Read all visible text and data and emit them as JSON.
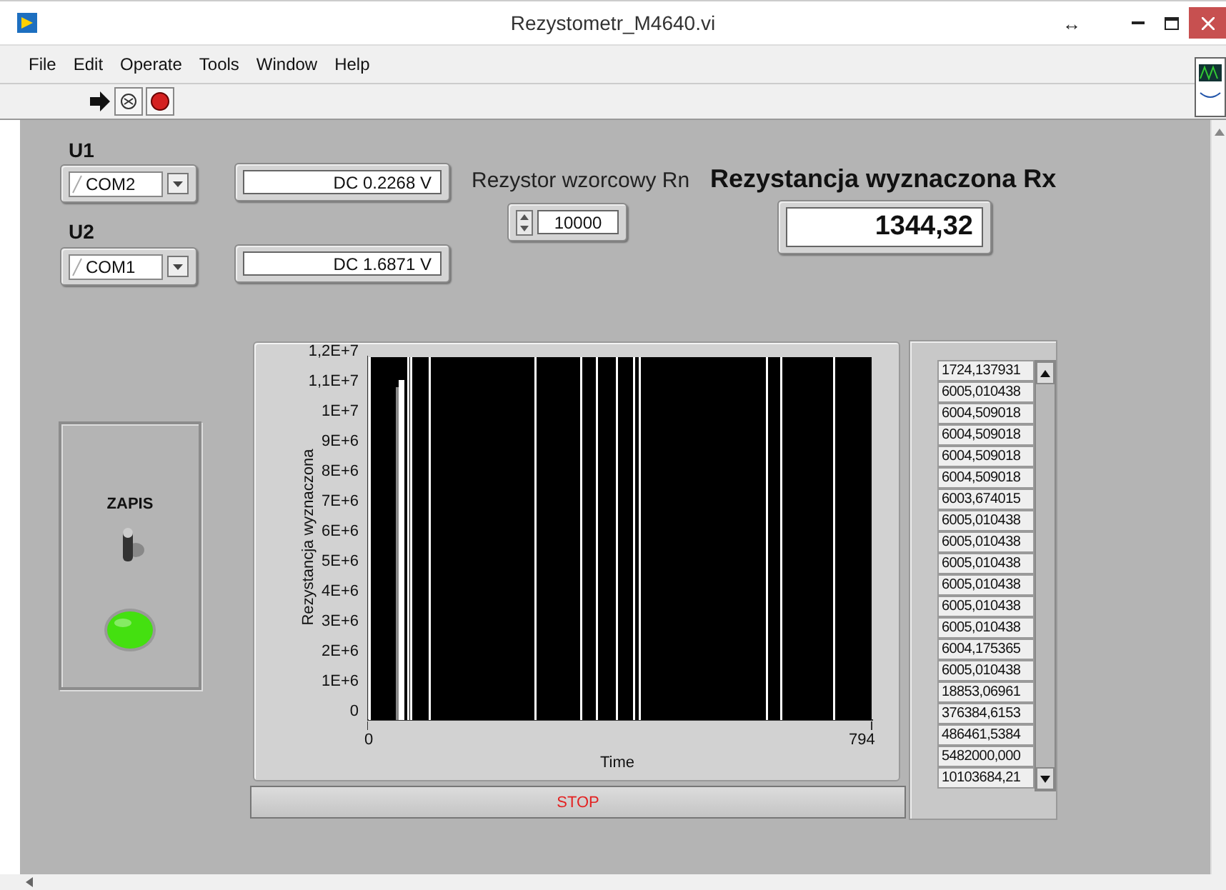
{
  "window": {
    "title": "Rezystometr_M4640.vi",
    "controls": [
      "↔"
    ]
  },
  "menu": [
    "File",
    "Edit",
    "Operate",
    "Tools",
    "Window",
    "Help"
  ],
  "toolbar": {
    "running": true
  },
  "u1": {
    "label": "U1",
    "port": "COM2",
    "reading": "DC 0.2268  V"
  },
  "u2": {
    "label": "U2",
    "port": "COM1",
    "reading": "DC 1.6871  V"
  },
  "reference": {
    "label": "Rezystor wzorcowy Rn",
    "value": "10000"
  },
  "result": {
    "label": "Rezystancja wyznaczona Rx",
    "value": "1344,32"
  },
  "record": {
    "label": "ZAPIS",
    "on": true,
    "led_on": true
  },
  "graph": {
    "ylabel": "Rezystancja wyznaczona",
    "xlabel": "Time",
    "yticks": [
      "1,2E+7",
      "1,1E+7",
      "1E+7",
      "9E+6",
      "8E+6",
      "7E+6",
      "6E+6",
      "5E+6",
      "4E+6",
      "3E+6",
      "2E+6",
      "1E+6",
      "0"
    ],
    "xticks": [
      "0",
      "794"
    ]
  },
  "stop_button": "STOP",
  "array": [
    "1724,137931",
    "6005,010438",
    "6004,509018",
    "6004,509018",
    "6004,509018",
    "6004,509018",
    "6003,674015",
    "6005,010438",
    "6005,010438",
    "6005,010438",
    "6005,010438",
    "6005,010438",
    "6005,010438",
    "6004,175365",
    "6005,010438",
    "18853,06961",
    "376384,6153",
    "486461,5384",
    "5482000,000",
    "10103684,21"
  ]
}
